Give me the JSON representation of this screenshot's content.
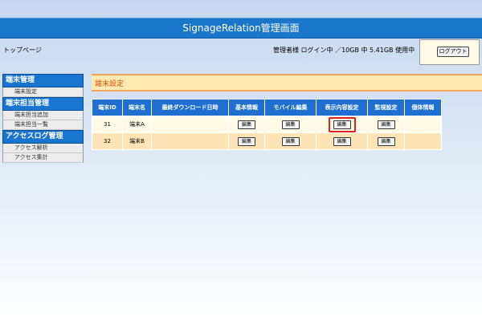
{
  "header": {
    "title": "SignageRelation管理画面"
  },
  "breadcrumb": "トップページ",
  "status_text": "管理者様 ログイン中 ／10GB 中 5.41GB 使用中",
  "logout_label": "ログアウト",
  "sidebar": {
    "groups": [
      {
        "title": "端末管理",
        "items": [
          "端末設定"
        ]
      },
      {
        "title": "端末担当管理",
        "items": [
          "端末担当追加",
          "端末担当一覧"
        ]
      },
      {
        "title": "アクセスログ管理",
        "items": [
          "アクセス解析",
          "アクセス集計"
        ]
      }
    ]
  },
  "section_title": "端末設定",
  "table": {
    "headers": [
      "端末ID",
      "端末名",
      "最終ダウンロード日時",
      "基本情報",
      "モバイル編集",
      "表示内容設定",
      "監視設定",
      "個体情報"
    ],
    "edit_label": "編集",
    "rows": [
      {
        "id": "31",
        "name": "端末A",
        "last_download": ""
      },
      {
        "id": "32",
        "name": "端末B",
        "last_download": ""
      }
    ]
  },
  "colors": {
    "header_bar": "#1976c8",
    "highlight": "#e02020",
    "section_title": "#d05000"
  }
}
